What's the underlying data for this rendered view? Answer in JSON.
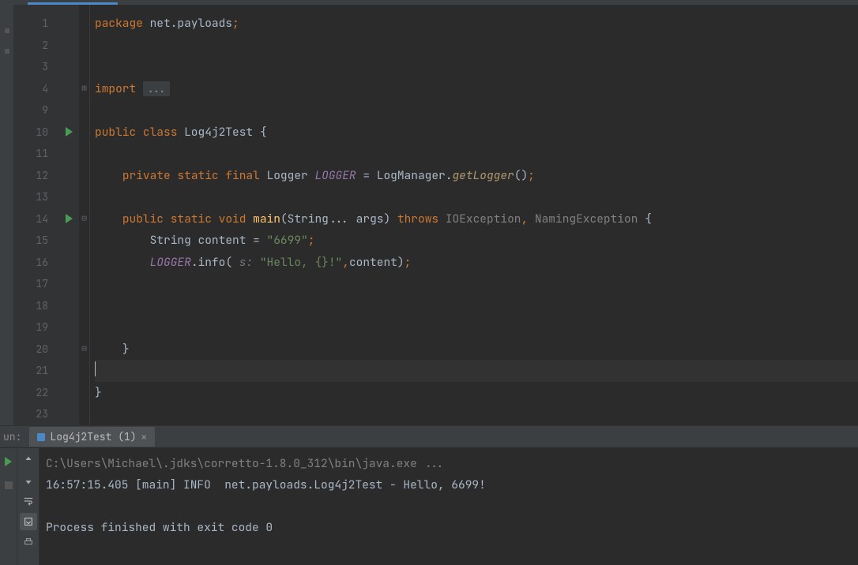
{
  "editor": {
    "lineNumbers": [
      "1",
      "2",
      "3",
      "4",
      "9",
      "10",
      "11",
      "12",
      "13",
      "14",
      "15",
      "16",
      "17",
      "18",
      "19",
      "20",
      "21",
      "22",
      "23"
    ],
    "runMarkers": {
      "10": true,
      "14": true
    },
    "code": {
      "l1": {
        "kw1": "package",
        "ns": "net.payloads",
        "semi": ";"
      },
      "l4": {
        "kw": "import",
        "fold": "..."
      },
      "l10": {
        "kw1": "public",
        "kw2": "class",
        "cls": "Log4j2Test",
        "brace": "{"
      },
      "l12": {
        "kw1": "private",
        "kw2": "static",
        "kw3": "final",
        "type": "Logger",
        "fld": "LOGGER",
        "eq": "=",
        "obj": "LogManager",
        "dot": ".",
        "mth": "getLogger",
        "paren": "()",
        "semi": ";"
      },
      "l14": {
        "kw1": "public",
        "kw2": "static",
        "kw3": "void",
        "mth": "main",
        "lp": "(",
        "ptype": "String...",
        "pname": "args",
        "rp": ")",
        "kw4": "throws",
        "ex1": "IOException",
        "comma": ",",
        "ex2": "NamingException",
        "brace": "{"
      },
      "l15": {
        "type": "String",
        "var": "content",
        "eq": "=",
        "str": "\"6699\"",
        "semi": ";"
      },
      "l16": {
        "fld": "LOGGER",
        "dot": ".",
        "mth": "info",
        "lp": "(",
        "hint": "s:",
        "str": "\"Hello, {}!\"",
        "comma": ",",
        "arg": "content",
        "rp": ")",
        "semi": ";"
      },
      "l20": {
        "brace": "}"
      },
      "l22": {
        "brace": "}"
      }
    }
  },
  "runPanel": {
    "label": "un:",
    "tab": "Log4j2Test (1)",
    "console": {
      "line1": "C:\\Users\\Michael\\.jdks\\corretto-1.8.0_312\\bin\\java.exe ...",
      "line2": "16:57:15.405 [main] INFO  net.payloads.Log4j2Test - Hello, 6699!",
      "line3": "",
      "line4": "Process finished with exit code 0"
    }
  }
}
